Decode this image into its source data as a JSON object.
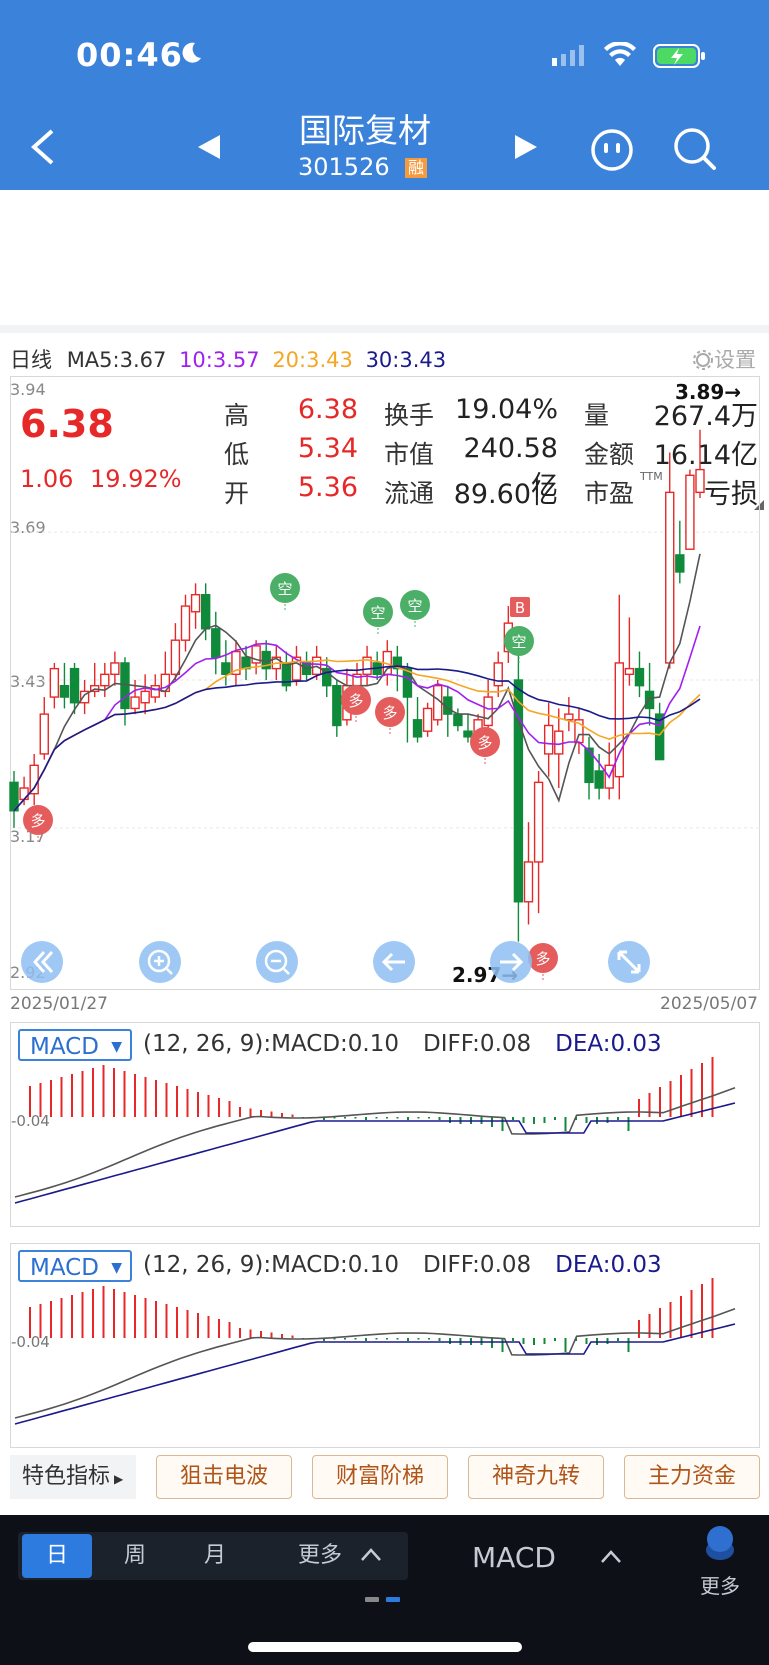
{
  "status": {
    "time": "00:46"
  },
  "header": {
    "title": "国际复材",
    "code": "301526",
    "badge": "融"
  },
  "quote": {
    "price": "6.38",
    "change": "1.06",
    "change_pct": "19.92%",
    "rows": [
      {
        "l1": "高",
        "v1": "6.38",
        "l2": "换手",
        "v2": "19.04%",
        "l3": "量",
        "v3": "267.4万"
      },
      {
        "l1": "低",
        "v1": "5.34",
        "l2": "市值",
        "v2": "240.58亿",
        "l3": "金额",
        "v3": "16.14亿"
      },
      {
        "l1": "开",
        "v1": "5.36",
        "l2": "流通",
        "v2": "89.60亿",
        "l3": "市盈",
        "v3": "亏损",
        "sup": "TTM"
      }
    ]
  },
  "kline": {
    "period": "日线",
    "ma": [
      {
        "label": "MA5:3.67",
        "color": "#555555"
      },
      {
        "label": "10:3.57",
        "color": "#a020f0"
      },
      {
        "label": "20:3.43",
        "color": "#f5a623"
      },
      {
        "label": "30:3.43",
        "color": "#1a1a8c"
      }
    ],
    "settings": "设置",
    "y_labels": [
      "3.94",
      "3.69",
      "3.43",
      "3.17",
      "2.92"
    ],
    "high_marker": "3.89→",
    "low_marker": "2.97→",
    "start_date": "2025/01/27",
    "end_date": "2025/05/07",
    "signal_duo": "多",
    "signal_kong": "空",
    "signal_b": "B",
    "colors": {
      "up": "#e62828",
      "down": "#0f8a3a"
    }
  },
  "macd_panels": [
    {
      "btn": "MACD",
      "params": "(12, 26, 9):MACD:0.10",
      "diff": "DIFF:0.08",
      "dea": "DEA:0.03",
      "zero": "-0.04"
    },
    {
      "btn": "MACD",
      "params": "(12, 26, 9):MACD:0.10",
      "diff": "DIFF:0.08",
      "dea": "DEA:0.03",
      "zero": "-0.04"
    }
  ],
  "features": {
    "label": "特色指标",
    "items": [
      "狙击电波",
      "财富阶梯",
      "神奇九转",
      "主力资金"
    ]
  },
  "bottom": {
    "tabs": [
      "日",
      "周",
      "月",
      "更多"
    ],
    "indicator": "MACD",
    "more": "更多"
  }
}
